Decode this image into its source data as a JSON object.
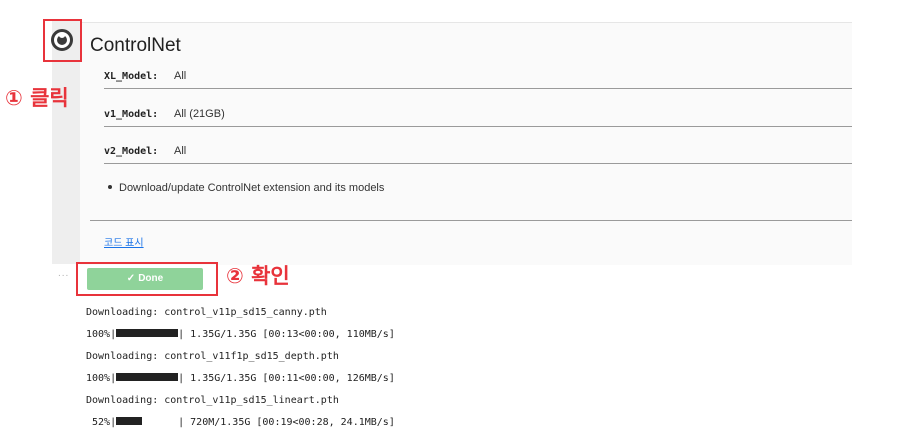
{
  "cell": {
    "title": "ControlNet",
    "run_icon": "play-circle-icon"
  },
  "annotations": {
    "step1": "① 클릭",
    "step2": "② 확인"
  },
  "form": {
    "xl_model": {
      "label": "XL_Model:",
      "value": "All"
    },
    "v1_model": {
      "label": "v1_Model:",
      "value": "All (21GB)"
    },
    "v2_model": {
      "label": "v2_Model:",
      "value": "All"
    }
  },
  "description": "Download/update ControlNet extension and its models",
  "show_code_label": "코드 표시",
  "output": {
    "ellipsis": "...",
    "done_label": "Done",
    "done_icon": "check-icon",
    "log": [
      {
        "text": "Downloading: control_v11p_sd15_canny.pth"
      },
      {
        "prefix": "100%|",
        "progress": 1.0,
        "suffix": "| 1.35G/1.35G [00:13<00:00, 110MB/s]"
      },
      {
        "text": "Downloading: control_v11f1p_sd15_depth.pth"
      },
      {
        "prefix": "100%|",
        "progress": 1.0,
        "suffix": "| 1.35G/1.35G [00:11<00:00, 126MB/s]"
      },
      {
        "text": "Downloading: control_v11p_sd15_lineart.pth"
      },
      {
        "prefix": " 52%|",
        "progress": 0.52,
        "suffix": "| 720M/1.35G [00:19<00:28, 24.1MB/s]"
      }
    ]
  },
  "colors": {
    "annotation_red": "#e8333b",
    "done_green": "#8fd39a",
    "link_blue": "#1a73e8"
  }
}
